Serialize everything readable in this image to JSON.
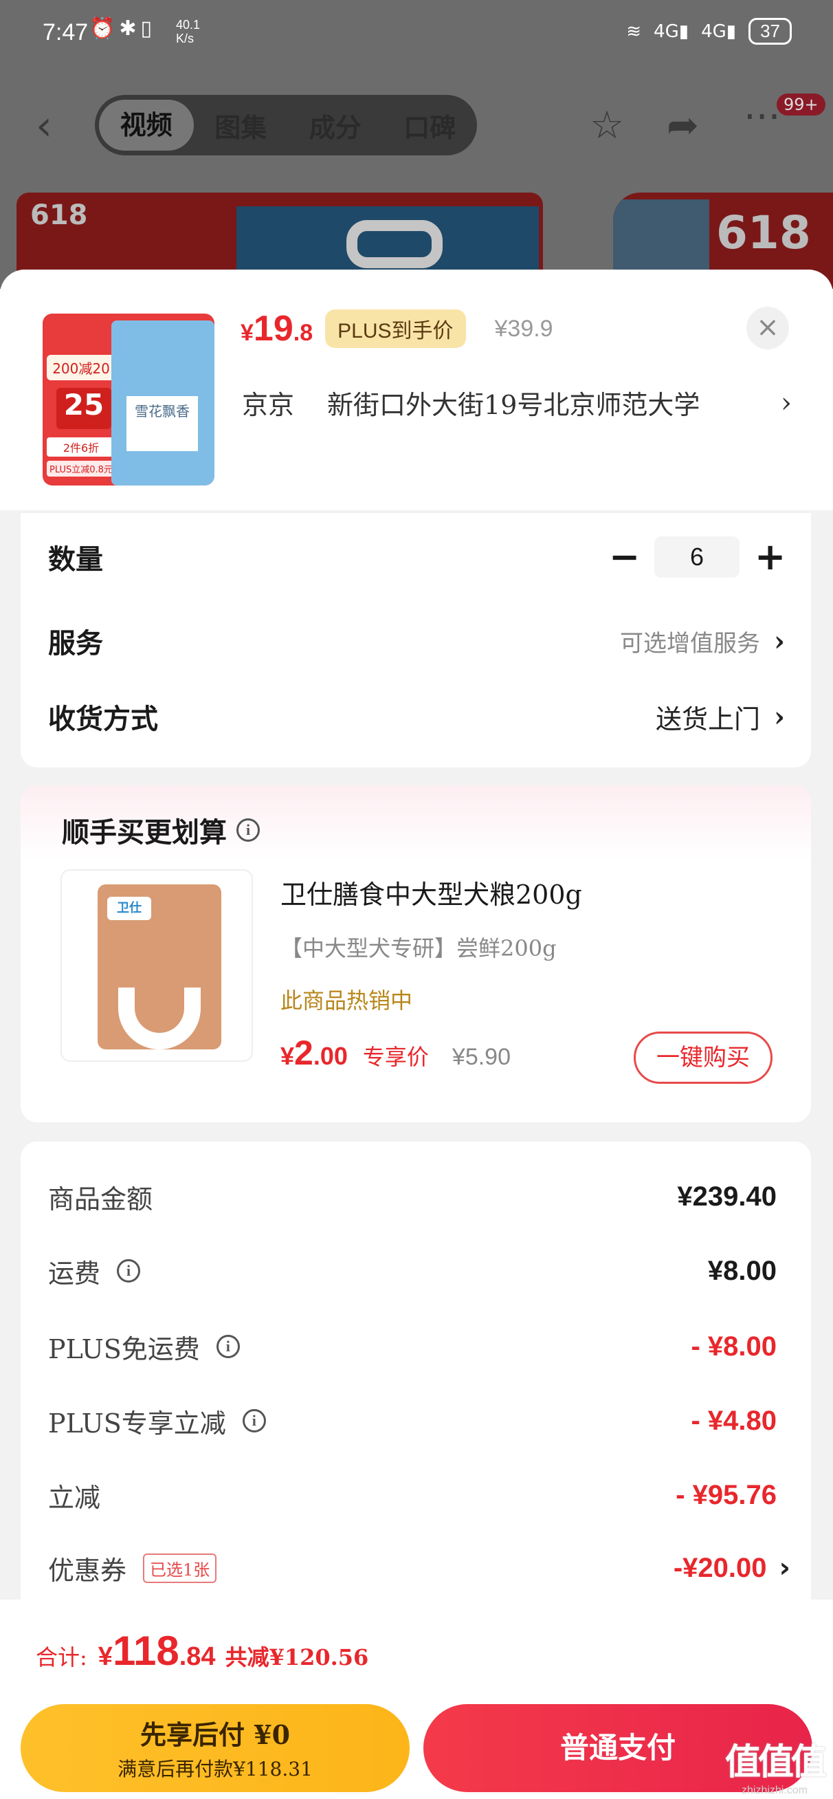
{
  "status_bar": {
    "time": "7:47",
    "speed": "40.1",
    "speed_unit": "K/s",
    "network1": "4G",
    "network2": "4G",
    "battery": "37"
  },
  "nav": {
    "tabs": [
      {
        "label": "视频",
        "active": true
      },
      {
        "label": "图集",
        "active": false
      },
      {
        "label": "成分",
        "active": false
      },
      {
        "label": "口碑",
        "active": false
      }
    ],
    "badge": "99+"
  },
  "background_banner": {
    "left_tag": "618",
    "right_tag": "618"
  },
  "product": {
    "price_symbol": "¥",
    "price_int": "19",
    "price_dec": ".8",
    "plus_label": "PLUS到手价",
    "original_price": "¥39.9",
    "thumb": {
      "promo": "200减20",
      "discount_big": "25",
      "discount_line": "2件6折",
      "plus_line": "PLUS立减0.8元",
      "bag_name": "雪花飘香"
    }
  },
  "address": {
    "city": "京京",
    "street": "新街口外大街19号北京师范大学"
  },
  "options": {
    "quantity_label": "数量",
    "quantity_value": "6",
    "service_label": "服务",
    "service_value": "可选增值服务",
    "delivery_label": "收货方式",
    "delivery_value": "送货上门"
  },
  "upsell": {
    "title": "顺手买更划算",
    "brand_logo": "卫仕",
    "name": "卫仕膳食中大型犬粮200g",
    "subtitle": "【中大型犬专研】尝鲜200g",
    "hot_text": "此商品热销中",
    "price_symbol": "¥",
    "price_int": "2",
    "price_dec": ".00",
    "price_tag": "专享价",
    "original_price": "¥5.90",
    "buy_label": "一键购买"
  },
  "summary": {
    "rows": [
      {
        "label": "商品金额",
        "value": "¥239.40",
        "info": false,
        "red": false
      },
      {
        "label": "运费",
        "value": "¥8.00",
        "info": true,
        "red": false
      },
      {
        "label": "PLUS免运费",
        "value": "- ¥8.00",
        "info": true,
        "red": true
      },
      {
        "label": "PLUS专享立减",
        "value": "- ¥4.80",
        "info": true,
        "red": true
      },
      {
        "label": "立减",
        "value": "- ¥95.76",
        "info": false,
        "red": true
      },
      {
        "label": "优惠券",
        "value": "-¥20.00",
        "info": false,
        "red": true,
        "chip": "已选1张"
      }
    ]
  },
  "bottom": {
    "total_label": "合计:",
    "total_symbol": "¥",
    "total_int": "118",
    "total_dec": ".84",
    "saved": "共减¥120.56",
    "pay_later_main": "先享后付 ¥0",
    "pay_later_sub": "满意后再付款¥118.31",
    "pay_normal": "普通支付"
  },
  "watermark": {
    "logo": "值值值",
    "url": "zhizhizhi.com"
  },
  "colors": {
    "accent_red": "#e8272c",
    "plus_gold": "#f9e4a8",
    "pay_later_yellow": "#fec02a",
    "hot_text": "#b8861a"
  }
}
